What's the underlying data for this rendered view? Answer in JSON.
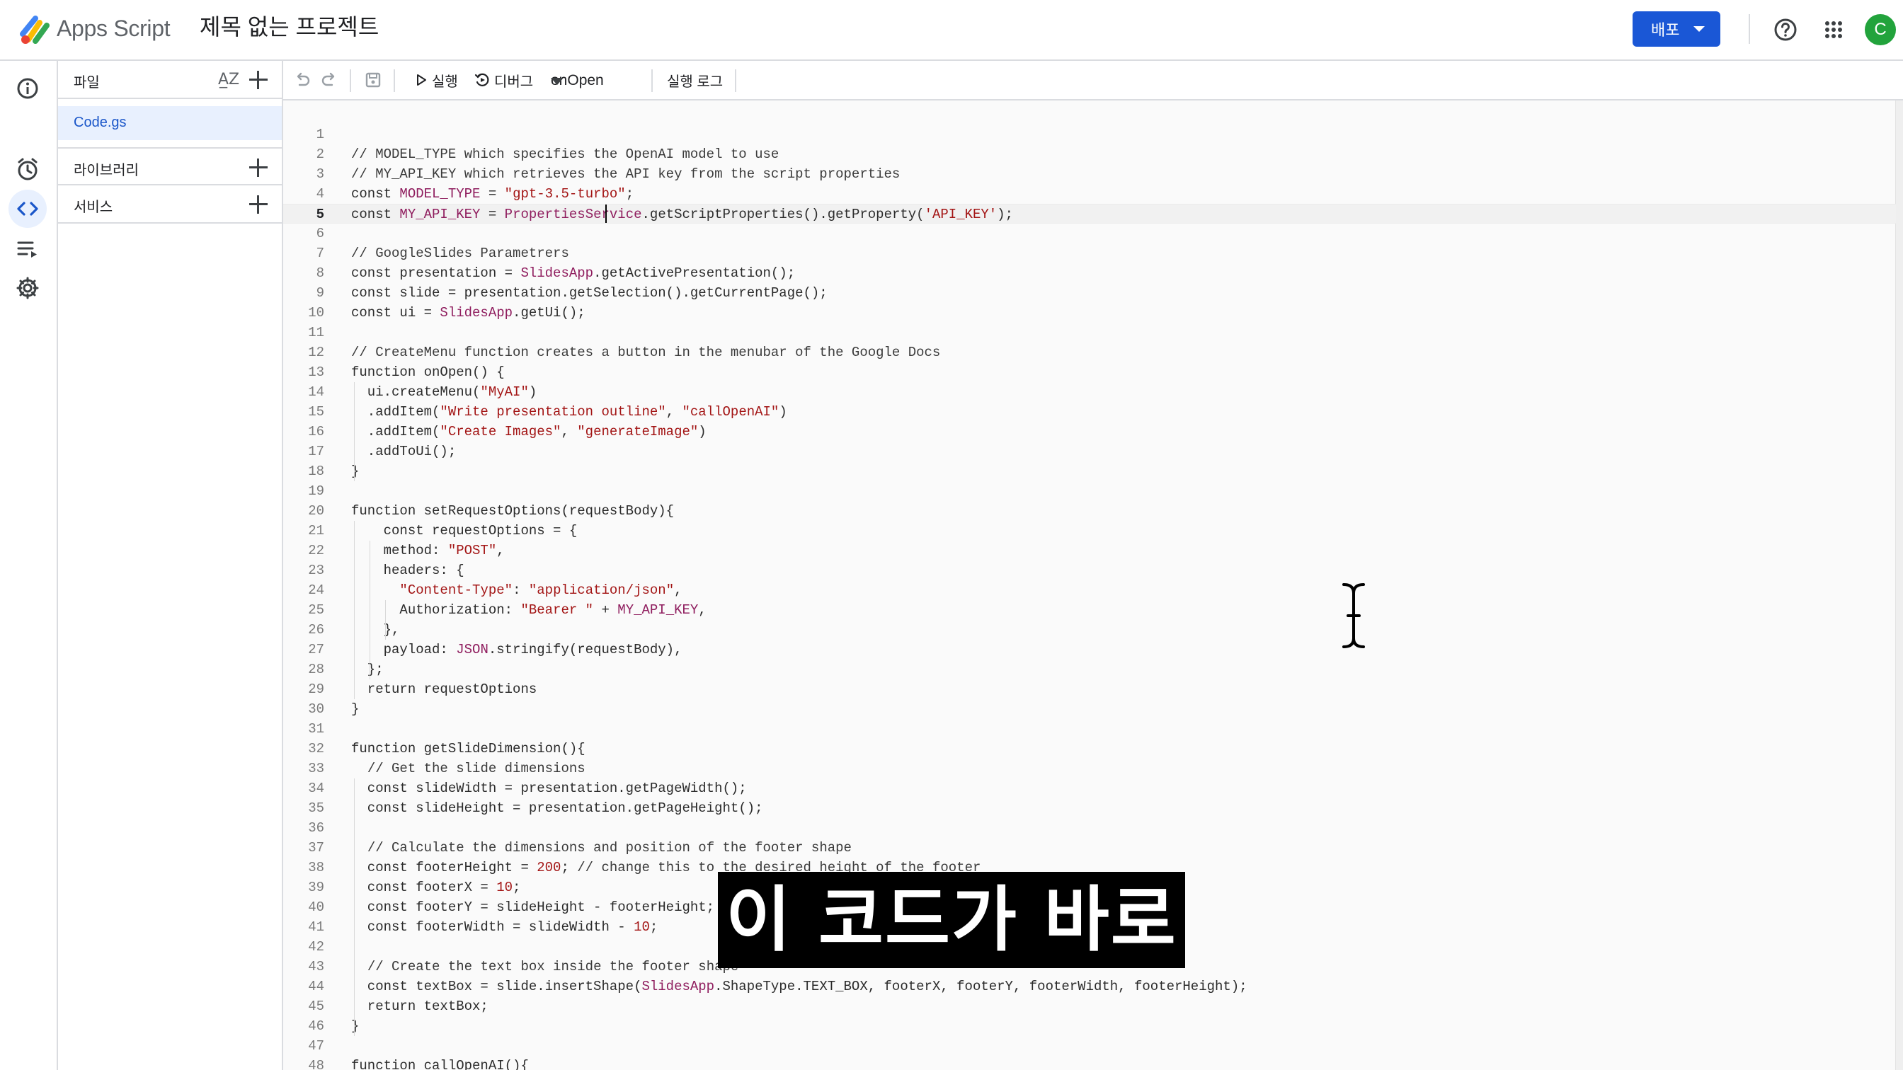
{
  "header": {
    "app_name": "Apps Script",
    "project_title": "제목 없는 프로젝트",
    "deploy_label": "배포",
    "avatar_letter": "C",
    "icons": [
      "help-icon",
      "apps-grid-icon"
    ]
  },
  "rail": {
    "items": [
      "overview-icon",
      "editor-icon",
      "triggers-icon",
      "executions-icon",
      "settings-icon"
    ],
    "active": "editor-icon"
  },
  "files_panel": {
    "files_label": "파일",
    "files": [
      "Code.gs"
    ],
    "libraries_label": "라이브러리",
    "services_label": "서비스"
  },
  "toolbar": {
    "run_label": "실행",
    "debug_label": "디버그",
    "function_selected": "onOpen",
    "log_label": "실행 로그"
  },
  "editor": {
    "current_line": 5,
    "lines": [
      "",
      "// MODEL_TYPE which specifies the OpenAI model to use",
      "// MY_API_KEY which retrieves the API key from the script properties",
      "const MODEL_TYPE = \"gpt-3.5-turbo\";",
      "const MY_API_KEY = PropertiesService.getScriptProperties().getProperty('API_KEY');",
      "",
      "// GoogleSlides Parametrers",
      "const presentation = SlidesApp.getActivePresentation();",
      "const slide = presentation.getSelection().getCurrentPage();",
      "const ui = SlidesApp.getUi();",
      "",
      "// CreateMenu function creates a button in the menubar of the Google Docs",
      "function onOpen() {",
      "  ui.createMenu(\"MyAI\")",
      "  .addItem(\"Write presentation outline\", \"callOpenAI\")",
      "  .addItem(\"Create Images\", \"generateImage\")",
      "  .addToUi();",
      "}",
      "",
      "function setRequestOptions(requestBody){",
      "    const requestOptions = {",
      "    method: \"POST\",",
      "    headers: {",
      "      \"Content-Type\": \"application/json\",",
      "      Authorization: \"Bearer \" + MY_API_KEY,",
      "    },",
      "    payload: JSON.stringify(requestBody),",
      "  };",
      "  return requestOptions",
      "}",
      "",
      "function getSlideDimension(){",
      "  // Get the slide dimensions",
      "  const slideWidth = presentation.getPageWidth();",
      "  const slideHeight = presentation.getPageHeight();",
      "",
      "  // Calculate the dimensions and position of the footer shape",
      "  const footerHeight = 200; // change this to the desired height of the footer",
      "  const footerX = 10;",
      "  const footerY = slideHeight - footerHeight;",
      "  const footerWidth = slideWidth - 10;",
      "",
      "  // Create the text box inside the footer shape",
      "  const textBox = slide.insertShape(SlidesApp.ShapeType.TEXT_BOX, footerX, footerY, footerWidth, footerHeight);",
      "  return textBox;",
      "}",
      "",
      "function callOpenAI(){"
    ]
  },
  "subtitle": "이 코드가 바로",
  "colors": {
    "keyword": "#2b2b2b",
    "string": "#a31515",
    "identifier": "#8f1d5e",
    "comment": "#3a3a3a",
    "accent": "#1a57d6",
    "selected_file_bg": "#e8f0fe"
  }
}
